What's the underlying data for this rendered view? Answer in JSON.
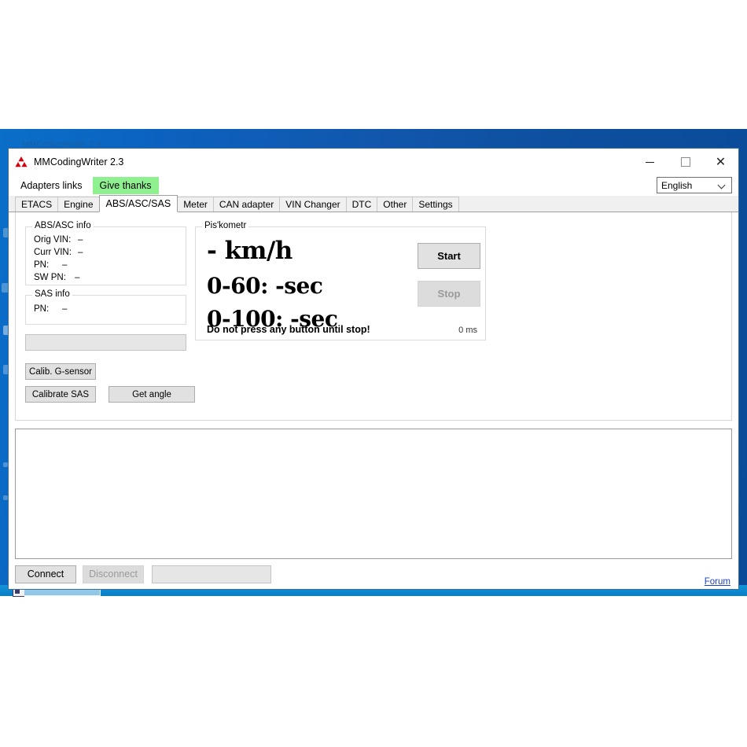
{
  "window": {
    "title": "MMCodingWriter 2.3",
    "logo_icon": "mitsubishi-three-diamond-icon",
    "minimize_icon": "minimize-icon",
    "maximize_icon": "maximize-icon",
    "close_icon": "close-icon",
    "ghost_text_above": "MMCodingWriter 2.3"
  },
  "menubar": {
    "adapters_links": "Adapters links",
    "give_thanks": "Give thanks",
    "give_thanks_color": "#8ff08f"
  },
  "language": {
    "selected": "English",
    "chevron_icon": "chevron-down-icon"
  },
  "tabs": [
    {
      "label": "ETACS",
      "active": false
    },
    {
      "label": "Engine",
      "active": false
    },
    {
      "label": "ABS/ASC/SAS",
      "active": true
    },
    {
      "label": "Meter",
      "active": false
    },
    {
      "label": "CAN adapter",
      "active": false
    },
    {
      "label": "VIN Changer",
      "active": false
    },
    {
      "label": "DTC",
      "active": false
    },
    {
      "label": "Other",
      "active": false
    },
    {
      "label": "Settings",
      "active": false
    }
  ],
  "abs_asc_info": {
    "title": "ABS/ASC info",
    "rows": [
      {
        "label": "Orig VIN:",
        "value": "–"
      },
      {
        "label": "Curr VIN:",
        "value": "–"
      },
      {
        "label": "PN:",
        "value": "–"
      },
      {
        "label": "SW PN:",
        "value": "–"
      }
    ]
  },
  "sas_info": {
    "title": "SAS info",
    "rows": [
      {
        "label": "PN:",
        "value": "–"
      }
    ]
  },
  "piskometr": {
    "title": "Pis'kometr",
    "speed": "- km/h",
    "zero_sixty": "0-60: -sec",
    "zero_hundred": "0-100: -sec",
    "hint": "Do not press any button until stop!",
    "ms": "0 ms",
    "start_button": "Start",
    "stop_button": "Stop",
    "stop_disabled": true
  },
  "calibration": {
    "calib_g_sensor": "Calib. G-sensor",
    "calibrate_sas": "Calibrate SAS",
    "get_angle": "Get angle"
  },
  "log": {
    "text": ""
  },
  "statusbar": {
    "connect": "Connect",
    "disconnect": "Disconnect",
    "disconnect_disabled": true,
    "status_value": "",
    "forum_link": "Forum"
  }
}
